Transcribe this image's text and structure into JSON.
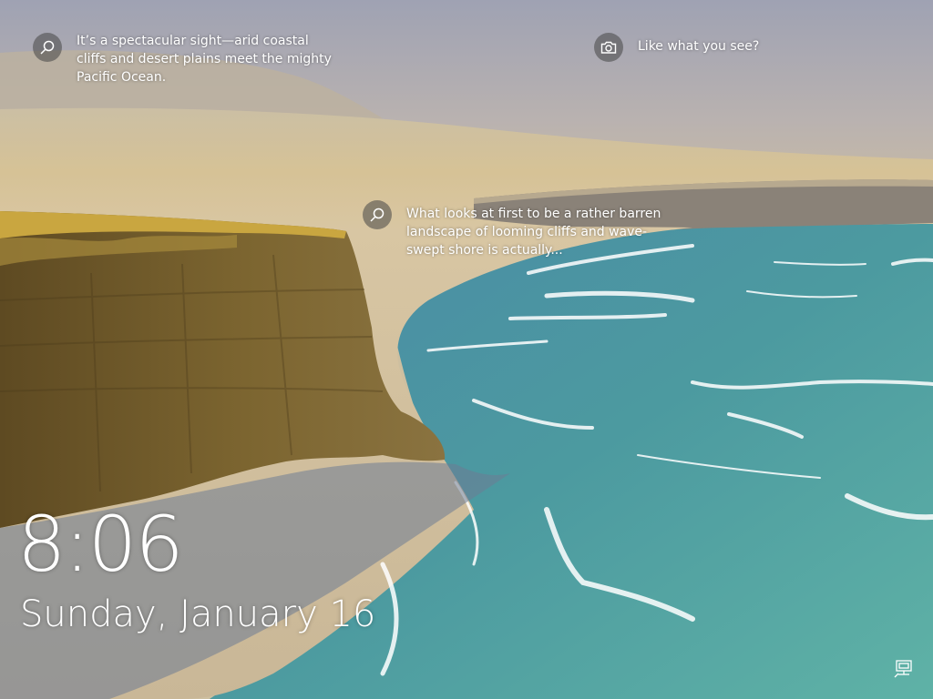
{
  "hotspots": [
    {
      "icon": "search-icon",
      "text": "It’s a spectacular sight—arid coastal cliffs and desert plains meet the mighty Pacific Ocean."
    },
    {
      "icon": "camera-icon",
      "text": "Like what you see?"
    },
    {
      "icon": "search-icon",
      "text": "What looks at first to be a rather barren landscape of looming cliffs and wave-swept shore is actually..."
    }
  ],
  "clock": {
    "time": "8:06",
    "date": "Sunday, January 16"
  },
  "status": {
    "icon": "network-icon"
  },
  "colors": {
    "sky": "#a8a6b1",
    "desert": "#d2c29b",
    "cliff": "#6e5a2a",
    "sea": "#4e9ea0",
    "sand": "#cbb79a",
    "text": "#ffffff"
  }
}
